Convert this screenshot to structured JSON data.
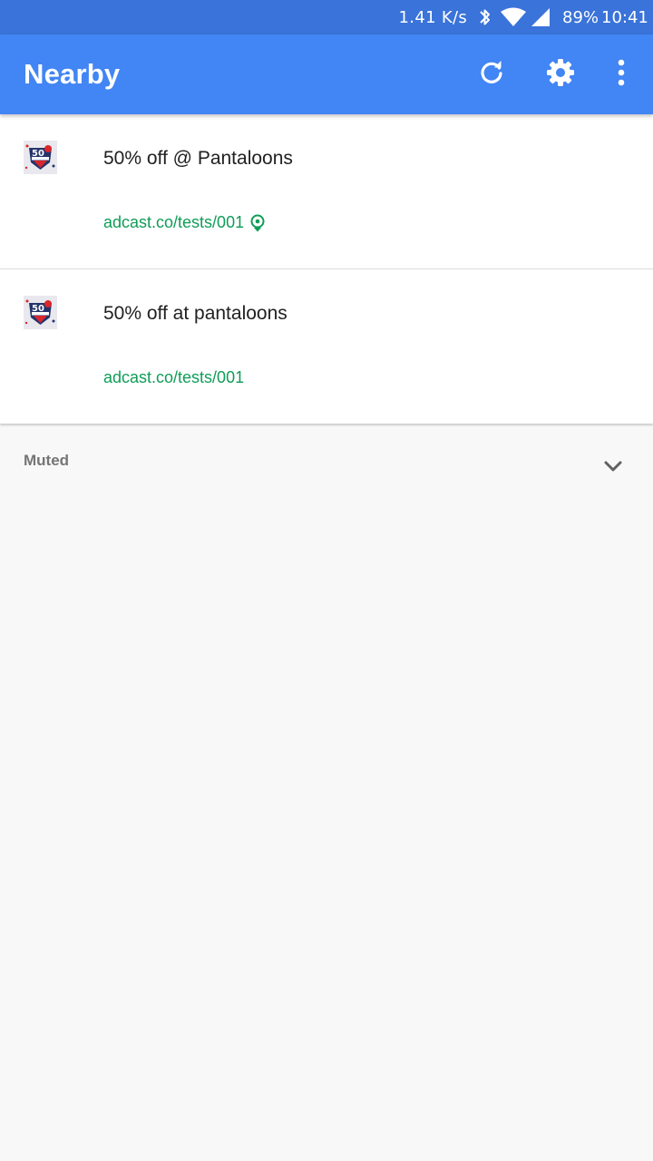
{
  "status_bar": {
    "net_speed": "1.41 K/s",
    "battery": "89%",
    "time": "10:41",
    "icons": [
      "bluetooth-icon",
      "wifi-icon",
      "cell-signal-icon"
    ]
  },
  "app_bar": {
    "title": "Nearby",
    "actions": [
      "refresh-icon",
      "settings-gear-icon",
      "more-vert-icon"
    ],
    "color": "#4285f4"
  },
  "items": [
    {
      "title": "50% off @ Pantaloons",
      "url": "adcast.co/tests/001",
      "thumbnail_icon": "sale-badge-50-icon",
      "beacon_icon": "beacon-location-icon"
    },
    {
      "title": "50% off at pantaloons",
      "url": "adcast.co/tests/001",
      "thumbnail_icon": "sale-badge-50-icon"
    }
  ],
  "muted": {
    "label": "Muted",
    "toggle_icon": "chevron-down-icon"
  },
  "colors": {
    "status_bar": "#3a73d9",
    "app_bar": "#4285f4",
    "url_green": "#0f9d58",
    "background": "#f8f8f8"
  }
}
